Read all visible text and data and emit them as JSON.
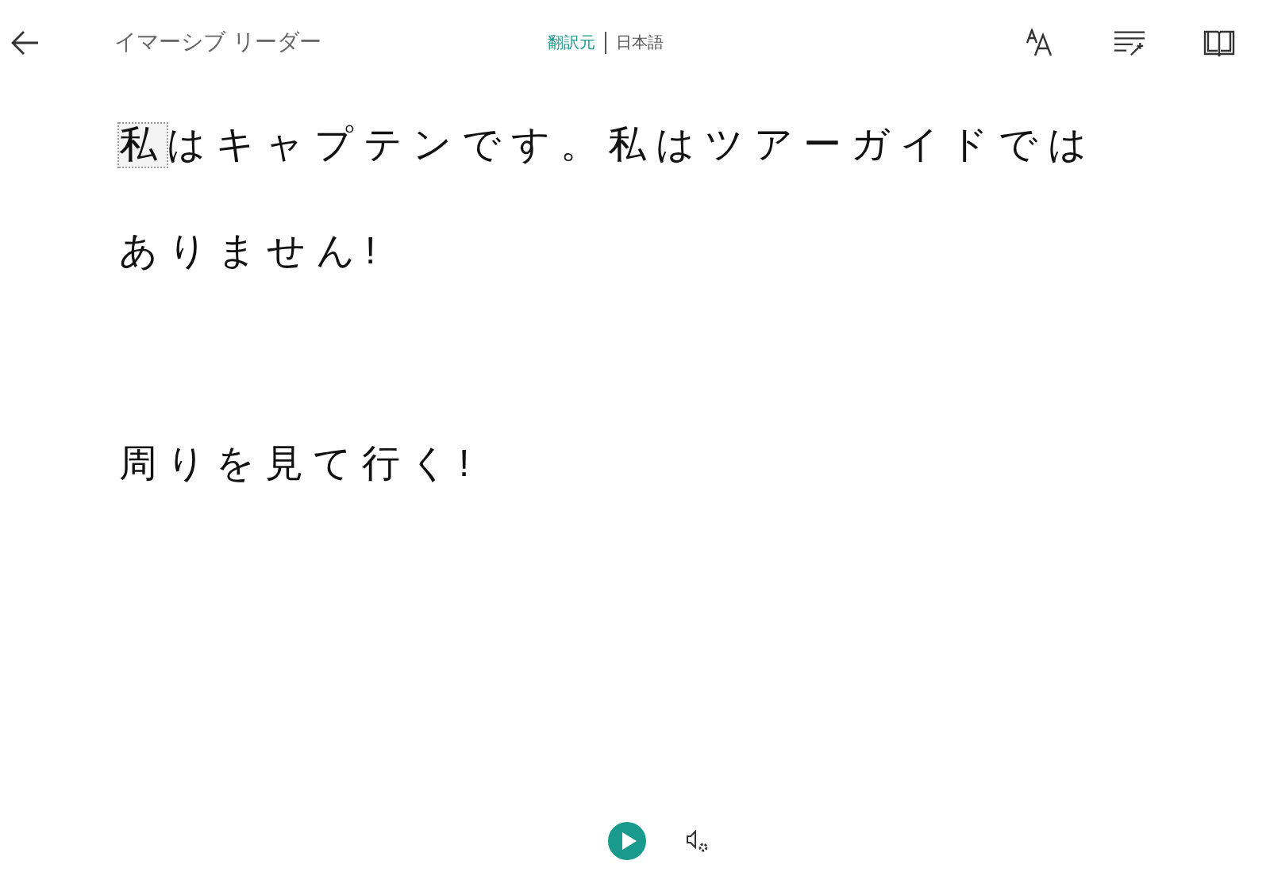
{
  "header": {
    "title": "イマーシブ リーダー",
    "source_label": "翻訳元",
    "language": "日本語"
  },
  "paragraphs": [
    {
      "lines": [
        {
          "words": [
            {
              "text": "私",
              "focused": true
            },
            {
              "text": "はキャプテンです。私はツアーガイドでは",
              "focused": false
            }
          ]
        },
        {
          "words": [
            {
              "text": "ありません!",
              "focused": false
            }
          ]
        }
      ]
    },
    {
      "lines": [
        {
          "words": [
            {
              "text": "周りを見て行く!",
              "focused": false
            }
          ]
        }
      ]
    }
  ]
}
